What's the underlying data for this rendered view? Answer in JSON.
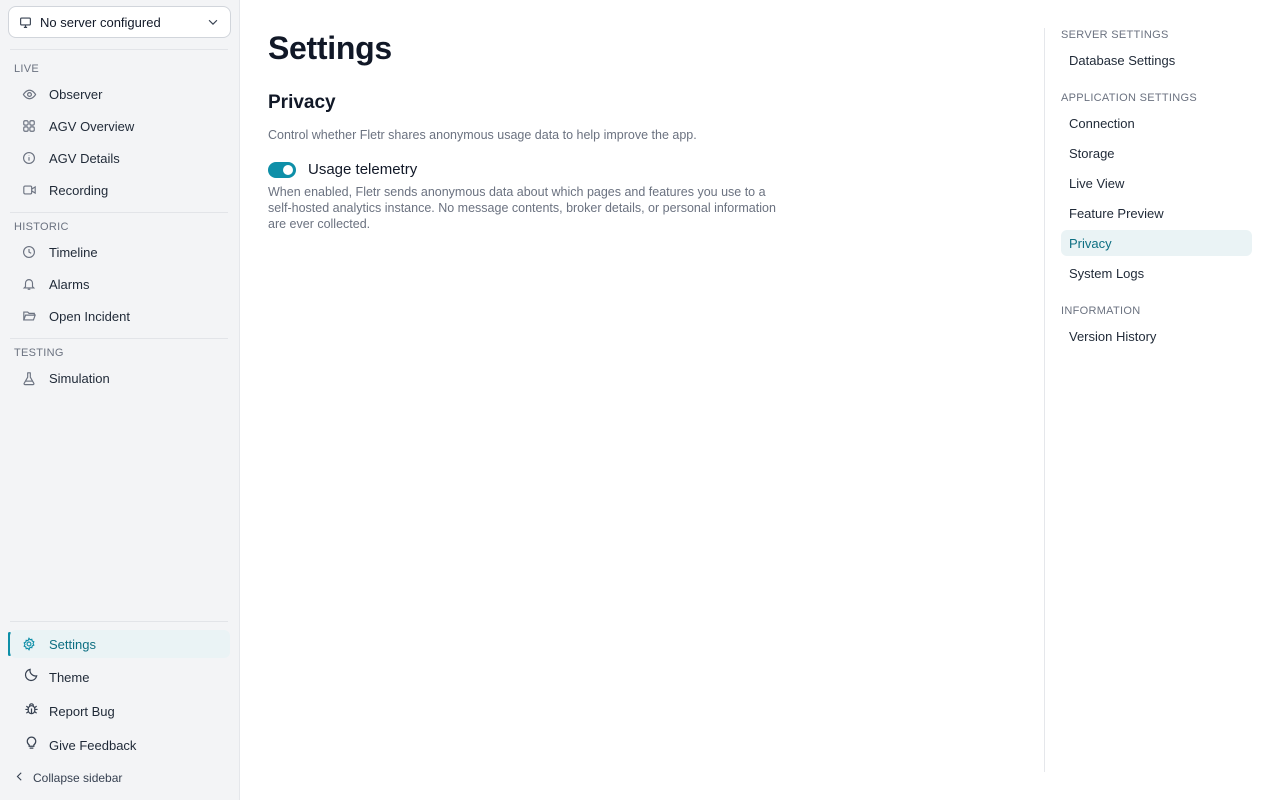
{
  "server_select": {
    "label": "No server configured",
    "icon": "monitor-icon"
  },
  "sidebar": {
    "sections": [
      {
        "title": "LIVE",
        "items": [
          {
            "label": "Observer",
            "icon": "eye-icon"
          },
          {
            "label": "AGV Overview",
            "icon": "grid-icon"
          },
          {
            "label": "AGV Details",
            "icon": "info-icon"
          },
          {
            "label": "Recording",
            "icon": "video-icon"
          }
        ]
      },
      {
        "title": "HISTORIC",
        "items": [
          {
            "label": "Timeline",
            "icon": "clock-icon"
          },
          {
            "label": "Alarms",
            "icon": "bell-icon"
          },
          {
            "label": "Open Incident",
            "icon": "folder-open-icon"
          }
        ]
      },
      {
        "title": "TESTING",
        "items": [
          {
            "label": "Simulation",
            "icon": "flask-icon"
          }
        ]
      }
    ],
    "bottom": {
      "settings": "Settings",
      "theme": "Theme",
      "report_bug": "Report Bug",
      "give_feedback": "Give Feedback",
      "collapse": "Collapse sidebar"
    }
  },
  "main": {
    "title": "Settings",
    "section_title": "Privacy",
    "section_desc": "Control whether Fletr shares anonymous usage data to help improve the app.",
    "toggle": {
      "label": "Usage telemetry",
      "enabled": true,
      "help": "When enabled, Fletr sends anonymous data about which pages and features you use to a self-hosted analytics instance. No message contents, broker details, or personal information are ever collected."
    }
  },
  "settings_nav": {
    "server_section": "SERVER SETTINGS",
    "server_items": [
      "Database Settings"
    ],
    "app_section": "APPLICATION SETTINGS",
    "app_items": [
      "Connection",
      "Storage",
      "Live View",
      "Feature Preview",
      "Privacy",
      "System Logs"
    ],
    "info_section": "INFORMATION",
    "info_items": [
      "Version History"
    ],
    "active": "Privacy"
  },
  "colors": {
    "accent": "#0e8fa8",
    "active_bg": "#eaf3f5",
    "active_text": "#0e6f82",
    "sidebar_bg": "#f3f4f6"
  }
}
